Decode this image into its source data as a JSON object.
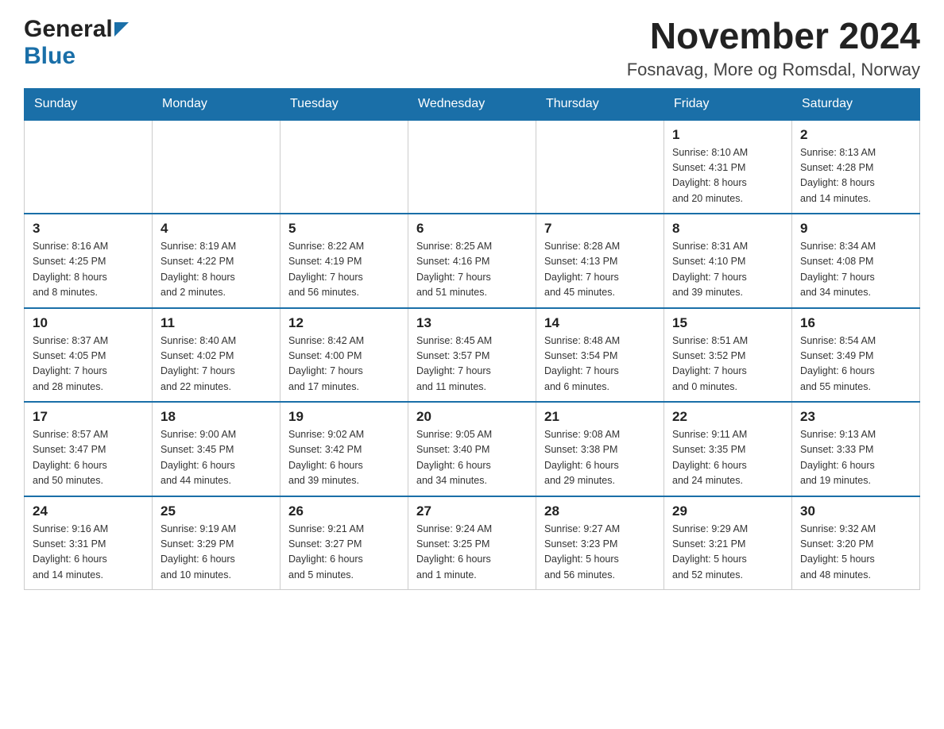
{
  "header": {
    "logo_general": "General",
    "logo_blue": "Blue",
    "month_title": "November 2024",
    "location": "Fosnavag, More og Romsdal, Norway"
  },
  "weekdays": [
    "Sunday",
    "Monday",
    "Tuesday",
    "Wednesday",
    "Thursday",
    "Friday",
    "Saturday"
  ],
  "weeks": [
    [
      {
        "day": "",
        "info": ""
      },
      {
        "day": "",
        "info": ""
      },
      {
        "day": "",
        "info": ""
      },
      {
        "day": "",
        "info": ""
      },
      {
        "day": "",
        "info": ""
      },
      {
        "day": "1",
        "info": "Sunrise: 8:10 AM\nSunset: 4:31 PM\nDaylight: 8 hours\nand 20 minutes."
      },
      {
        "day": "2",
        "info": "Sunrise: 8:13 AM\nSunset: 4:28 PM\nDaylight: 8 hours\nand 14 minutes."
      }
    ],
    [
      {
        "day": "3",
        "info": "Sunrise: 8:16 AM\nSunset: 4:25 PM\nDaylight: 8 hours\nand 8 minutes."
      },
      {
        "day": "4",
        "info": "Sunrise: 8:19 AM\nSunset: 4:22 PM\nDaylight: 8 hours\nand 2 minutes."
      },
      {
        "day": "5",
        "info": "Sunrise: 8:22 AM\nSunset: 4:19 PM\nDaylight: 7 hours\nand 56 minutes."
      },
      {
        "day": "6",
        "info": "Sunrise: 8:25 AM\nSunset: 4:16 PM\nDaylight: 7 hours\nand 51 minutes."
      },
      {
        "day": "7",
        "info": "Sunrise: 8:28 AM\nSunset: 4:13 PM\nDaylight: 7 hours\nand 45 minutes."
      },
      {
        "day": "8",
        "info": "Sunrise: 8:31 AM\nSunset: 4:10 PM\nDaylight: 7 hours\nand 39 minutes."
      },
      {
        "day": "9",
        "info": "Sunrise: 8:34 AM\nSunset: 4:08 PM\nDaylight: 7 hours\nand 34 minutes."
      }
    ],
    [
      {
        "day": "10",
        "info": "Sunrise: 8:37 AM\nSunset: 4:05 PM\nDaylight: 7 hours\nand 28 minutes."
      },
      {
        "day": "11",
        "info": "Sunrise: 8:40 AM\nSunset: 4:02 PM\nDaylight: 7 hours\nand 22 minutes."
      },
      {
        "day": "12",
        "info": "Sunrise: 8:42 AM\nSunset: 4:00 PM\nDaylight: 7 hours\nand 17 minutes."
      },
      {
        "day": "13",
        "info": "Sunrise: 8:45 AM\nSunset: 3:57 PM\nDaylight: 7 hours\nand 11 minutes."
      },
      {
        "day": "14",
        "info": "Sunrise: 8:48 AM\nSunset: 3:54 PM\nDaylight: 7 hours\nand 6 minutes."
      },
      {
        "day": "15",
        "info": "Sunrise: 8:51 AM\nSunset: 3:52 PM\nDaylight: 7 hours\nand 0 minutes."
      },
      {
        "day": "16",
        "info": "Sunrise: 8:54 AM\nSunset: 3:49 PM\nDaylight: 6 hours\nand 55 minutes."
      }
    ],
    [
      {
        "day": "17",
        "info": "Sunrise: 8:57 AM\nSunset: 3:47 PM\nDaylight: 6 hours\nand 50 minutes."
      },
      {
        "day": "18",
        "info": "Sunrise: 9:00 AM\nSunset: 3:45 PM\nDaylight: 6 hours\nand 44 minutes."
      },
      {
        "day": "19",
        "info": "Sunrise: 9:02 AM\nSunset: 3:42 PM\nDaylight: 6 hours\nand 39 minutes."
      },
      {
        "day": "20",
        "info": "Sunrise: 9:05 AM\nSunset: 3:40 PM\nDaylight: 6 hours\nand 34 minutes."
      },
      {
        "day": "21",
        "info": "Sunrise: 9:08 AM\nSunset: 3:38 PM\nDaylight: 6 hours\nand 29 minutes."
      },
      {
        "day": "22",
        "info": "Sunrise: 9:11 AM\nSunset: 3:35 PM\nDaylight: 6 hours\nand 24 minutes."
      },
      {
        "day": "23",
        "info": "Sunrise: 9:13 AM\nSunset: 3:33 PM\nDaylight: 6 hours\nand 19 minutes."
      }
    ],
    [
      {
        "day": "24",
        "info": "Sunrise: 9:16 AM\nSunset: 3:31 PM\nDaylight: 6 hours\nand 14 minutes."
      },
      {
        "day": "25",
        "info": "Sunrise: 9:19 AM\nSunset: 3:29 PM\nDaylight: 6 hours\nand 10 minutes."
      },
      {
        "day": "26",
        "info": "Sunrise: 9:21 AM\nSunset: 3:27 PM\nDaylight: 6 hours\nand 5 minutes."
      },
      {
        "day": "27",
        "info": "Sunrise: 9:24 AM\nSunset: 3:25 PM\nDaylight: 6 hours\nand 1 minute."
      },
      {
        "day": "28",
        "info": "Sunrise: 9:27 AM\nSunset: 3:23 PM\nDaylight: 5 hours\nand 56 minutes."
      },
      {
        "day": "29",
        "info": "Sunrise: 9:29 AM\nSunset: 3:21 PM\nDaylight: 5 hours\nand 52 minutes."
      },
      {
        "day": "30",
        "info": "Sunrise: 9:32 AM\nSunset: 3:20 PM\nDaylight: 5 hours\nand 48 minutes."
      }
    ]
  ]
}
